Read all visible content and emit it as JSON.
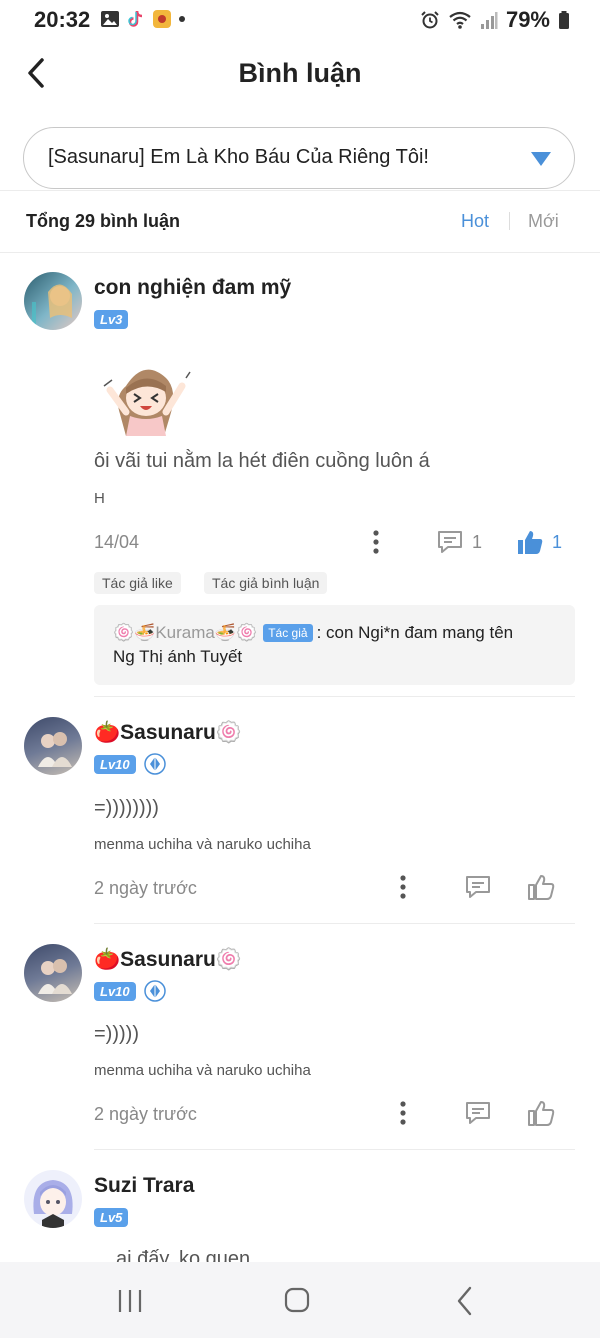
{
  "status_bar": {
    "time": "20:32",
    "battery": "79%",
    "left_icons": [
      "gallery-icon",
      "tiktok-icon",
      "app-icon",
      "dot-icon"
    ],
    "right_icons": [
      "alarm-icon",
      "wifi-icon",
      "signal-icon",
      "battery-icon"
    ]
  },
  "header": {
    "title": "Bình luận",
    "back_icon": "chevron-left-icon"
  },
  "selector": {
    "value": "[Sasunaru] Em Là Kho Báu Của Riêng Tôi!",
    "arrow_icon": "triangle-down-icon"
  },
  "sort_bar": {
    "total": "Tổng 29 bình luận",
    "hot": "Hot",
    "new": "Mới"
  },
  "colors": {
    "accent": "#4a90d9",
    "badge": "#5aa0ea"
  },
  "comments": [
    {
      "user": "con nghiện đam mỹ",
      "level": "Lv3",
      "sticker_icon": "cartoon-girl-sticker",
      "text": "ôi vãi tui nằm la hét điên cuồng luôn á",
      "subtext": "H",
      "date": "14/04",
      "reply_count": "1",
      "like_count": "1",
      "tags": [
        "Tác giả like",
        "Tác giả bình luận"
      ],
      "reply": {
        "author": "🍥🍜Kurama🍜🍥",
        "author_tag": "Tác giả",
        "text_line1": ": con Ngi*n đam mang tên",
        "text_line2": "Ng Thị ánh Tuyết"
      }
    },
    {
      "user": "🍅Sasunaru🍥",
      "level": "Lv10",
      "text": "=))))))))",
      "subtext": "menma uchiha và naruko uchiha",
      "date": "2 ngày trước"
    },
    {
      "user": "🍅Sasunaru🍥",
      "level": "Lv10",
      "text": "=)))))",
      "subtext": "menma uchiha và naruko uchiha",
      "date": "2 ngày trước"
    },
    {
      "user": "Suzi Trara",
      "level": "Lv5",
      "text": "ai đấy, ko quen"
    }
  ],
  "nav_bar": {
    "icons": [
      "recent-apps-icon",
      "home-icon",
      "back-icon"
    ]
  }
}
